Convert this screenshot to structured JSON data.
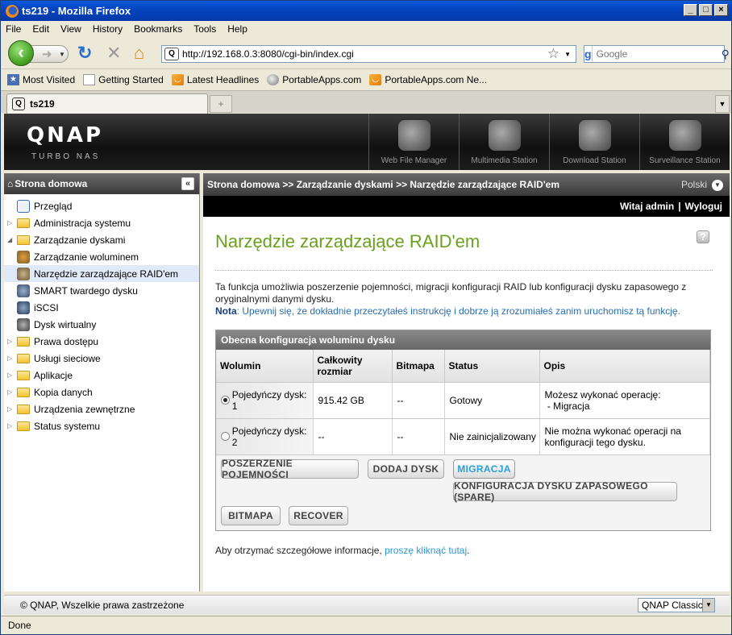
{
  "window": {
    "title": "ts219 - Mozilla Firefox"
  },
  "menu": [
    "File",
    "Edit",
    "View",
    "History",
    "Bookmarks",
    "Tools",
    "Help"
  ],
  "address": {
    "url": "http://192.168.0.3:8080/cgi-bin/index.cgi"
  },
  "search": {
    "placeholder": "Google"
  },
  "bookmarks": [
    "Most Visited",
    "Getting Started",
    "Latest Headlines",
    "PortableApps.com",
    "PortableApps.com Ne..."
  ],
  "tab": {
    "label": "ts219"
  },
  "qnap": {
    "logo": "QNAP",
    "sub": "TURBO NAS",
    "apps": [
      "Web File Manager",
      "Multimedia Station",
      "Download Station",
      "Surveillance Station"
    ]
  },
  "sidebar": {
    "title": "Strona domowa",
    "items": [
      {
        "label": "Przegląd"
      },
      {
        "label": "Administracja systemu"
      },
      {
        "label": "Zarządzanie dyskami"
      },
      {
        "label": "Zarządzanie woluminem"
      },
      {
        "label": "Narzędzie zarządzające RAID'em"
      },
      {
        "label": "SMART twardego dysku"
      },
      {
        "label": "iSCSI"
      },
      {
        "label": "Dysk wirtualny"
      },
      {
        "label": "Prawa dostępu"
      },
      {
        "label": "Usługi sieciowe"
      },
      {
        "label": "Aplikacje"
      },
      {
        "label": "Kopia danych"
      },
      {
        "label": "Urządzenia zewnętrzne"
      },
      {
        "label": "Status systemu"
      }
    ]
  },
  "breadcrumb": "Strona domowa >> Zarządzanie dyskami >> Narzędzie zarządzające RAID'em",
  "language": "Polski",
  "user": {
    "welcome": "Witaj admin",
    "logout": "Wyloguj"
  },
  "page": {
    "title": "Narzędzie zarządzające RAID'em",
    "description": "Ta funkcja umożliwia poszerzenie pojemności, migracji konfiguracji RAID lub konfiguracji dysku zapasowego z oryginalnymi danymi dysku.",
    "note_label": "Nota",
    "note_text": ": Upewnij się, że dokładnie przeczytałeś instrukcję i dobrze ją zrozumiałeś zanim uruchomisz tą funkcję.",
    "panel_title": "Obecna konfiguracja woluminu dysku",
    "columns": [
      "Wolumin",
      "Całkowity rozmiar",
      "Bitmapa",
      "Status",
      "Opis"
    ],
    "rows": [
      {
        "volume": "Pojedyńczy dysk: 1",
        "size": "915.42 GB",
        "bitmap": "--",
        "status": "Gotowy",
        "desc": "Możesz wykonać operację:",
        "desc2": " - Migracja"
      },
      {
        "volume": "Pojedyńczy dysk: 2",
        "size": "--",
        "bitmap": "--",
        "status": "Nie zainicjalizowany",
        "desc": "Nie można wykonać operacji na konfiguracji tego dysku.",
        "desc2": ""
      }
    ],
    "buttons": {
      "expand": "POSZERZENIE POJEMNOŚCI",
      "add": "DODAJ DYSK",
      "migrate": "MIGRACJA",
      "spare": "KONFIGURACJA DYSKU ZAPASOWEGO (SPARE)",
      "bitmap": "BITMAPA",
      "recover": "RECOVER"
    },
    "more_prefix": "Aby otrzymać szczegółowe informacje, ",
    "more_link": "proszę kliknąć tutaj",
    "more_suffix": "."
  },
  "footer": {
    "copyright": "© QNAP, Wszelkie prawa zastrzeżone",
    "theme": "QNAP Classic"
  },
  "statusbar": "Done"
}
